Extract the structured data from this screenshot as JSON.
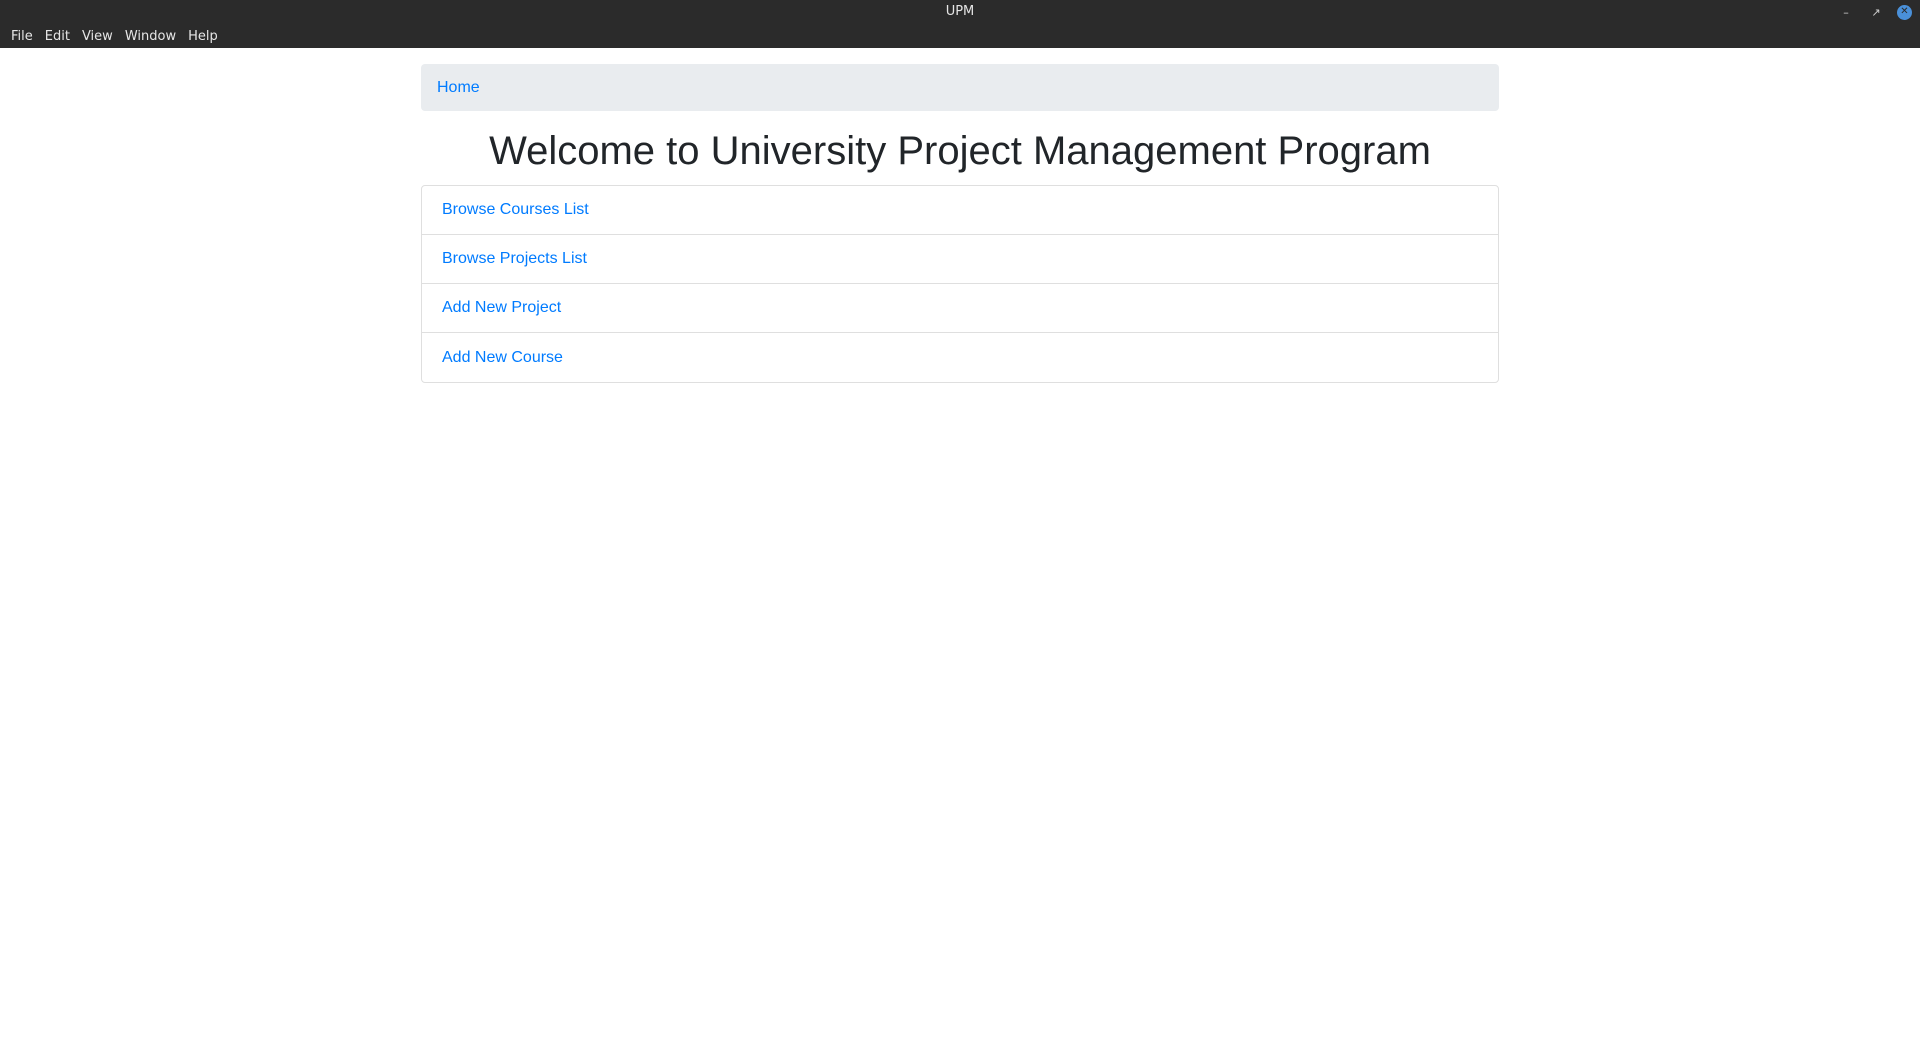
{
  "window": {
    "title": "UPM",
    "controls": {
      "minimize_icon": "minimize-icon",
      "maximize_icon": "maximize-icon",
      "close_icon": "close-icon"
    }
  },
  "menubar": {
    "items": [
      "File",
      "Edit",
      "View",
      "Window",
      "Help"
    ]
  },
  "breadcrumb": {
    "home": "Home"
  },
  "main": {
    "title": "Welcome to University Project Management Program",
    "links": [
      "Browse Courses List",
      "Browse Projects List",
      "Add New Project",
      "Add New Course"
    ]
  },
  "colors": {
    "link": "#007bff",
    "titlebar": "#2b2b2b",
    "breadcrumb_bg": "#e9ecef",
    "heading": "#212529"
  }
}
